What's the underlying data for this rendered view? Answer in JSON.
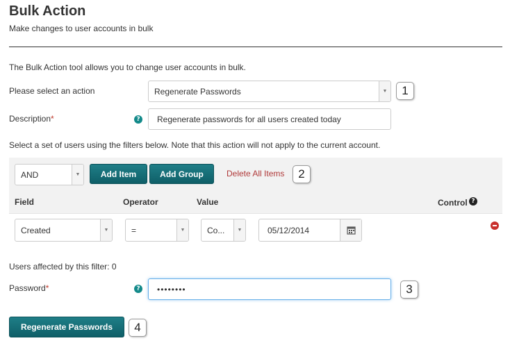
{
  "header": {
    "title": "Bulk Action",
    "subtitle": "Make changes to user accounts in bulk"
  },
  "intro": "The Bulk Action tool allows you to change user accounts in bulk.",
  "action": {
    "label": "Please select an action",
    "value": "Regenerate Passwords",
    "callout": "1"
  },
  "description": {
    "label": "Description",
    "required_mark": "*",
    "help_glyph": "?",
    "value": "Regenerate passwords for all users created today"
  },
  "filters_note": "Select a set of users using the filters below. Note that this action will not apply to the current account.",
  "filter_toolbar": {
    "logic_value": "AND",
    "add_item_label": "Add Item",
    "add_group_label": "Add Group",
    "delete_all_label": "Delete All Items",
    "callout": "2"
  },
  "filter_table": {
    "headers": {
      "field": "Field",
      "operator": "Operator",
      "value": "Value",
      "control": "Control"
    },
    "control_help_glyph": "?",
    "row": {
      "field": "Created",
      "operator": "=",
      "comparison": "Co...",
      "date": "05/12/2014"
    }
  },
  "affected_text": "Users affected by this filter: 0",
  "password": {
    "label": "Password",
    "required_mark": "*",
    "help_glyph": "?",
    "value": "••••••••",
    "callout": "3"
  },
  "submit": {
    "label": "Regenerate Passwords",
    "callout": "4"
  },
  "colors": {
    "accent": "#138a8a",
    "button": "#1a6f78",
    "danger": "#c9302c",
    "link": "#b03a3a"
  }
}
